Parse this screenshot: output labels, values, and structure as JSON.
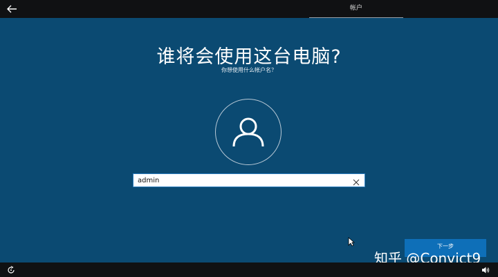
{
  "header": {
    "back_icon": "back-arrow-icon",
    "step_label": "帐户"
  },
  "main": {
    "title": "谁将会使用这台电脑?",
    "subtitle": "你想使用什么帐户名？",
    "avatar_icon": "user-icon",
    "username": {
      "value": "admin",
      "placeholder": ""
    },
    "clear_icon": "close-icon"
  },
  "footer": {
    "next_label": "下一步",
    "watermark": "知乎 @Convict9",
    "ease_of_access_icon": "ease-of-access-icon",
    "volume_icon": "volume-icon"
  },
  "colors": {
    "background": "#0b4a72",
    "bar": "#101113",
    "accent": "#0e6fb8"
  }
}
